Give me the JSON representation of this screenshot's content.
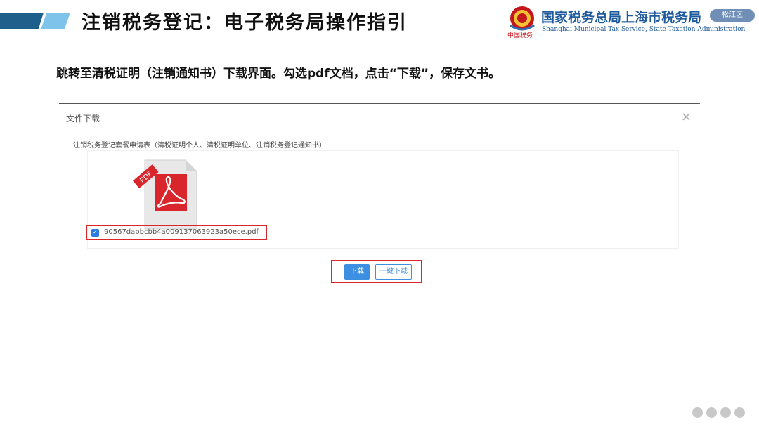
{
  "header": {
    "title": "注销税务登记：电子税务局操作指引",
    "org_name": "国家税务总局上海市税务局",
    "org_name_en": "Shanghai Municipal Tax Service, State Taxation Administration",
    "emblem_subtext": "中国税务",
    "district": "松江区"
  },
  "instruction": "跳转至清税证明（注销通知书）下载界面。勾选pdf文档，点击“下载”，保存文书。",
  "dialog": {
    "title": "文件下载",
    "close": "×",
    "section_title": "注销税务登记套餐申请表（清税证明个人、清税证明单位、注销税务登记通知书）",
    "file": {
      "icon_label": "PDF",
      "filename": "90567dabbcbb4a009137063923a50ece.pdf",
      "checked": true,
      "check_glyph": "✓"
    },
    "buttons": {
      "download": "下载",
      "download_all": "一键下载"
    }
  },
  "colors": {
    "accent": "#3d8fe2",
    "highlight": "#d9262b",
    "brand": "#1f5a9c"
  }
}
